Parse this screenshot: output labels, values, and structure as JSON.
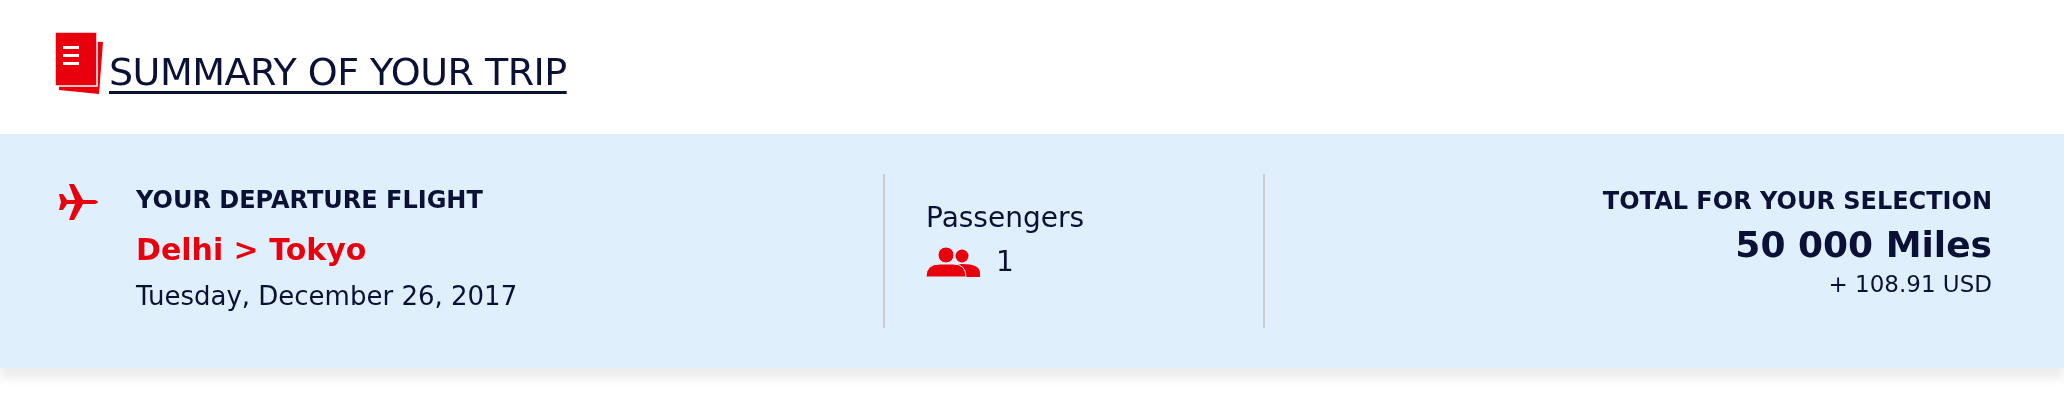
{
  "title": "SUMMARY OF YOUR TRIP",
  "flight": {
    "heading": "YOUR DEPARTURE FLIGHT",
    "route": "Delhi > Tokyo",
    "date": "Tuesday, December 26, 2017"
  },
  "passengers": {
    "label": "Passengers",
    "count": "1"
  },
  "total": {
    "heading": "TOTAL FOR YOUR SELECTION",
    "miles": "50 000 Miles",
    "fees": "+ 108.91 USD"
  }
}
